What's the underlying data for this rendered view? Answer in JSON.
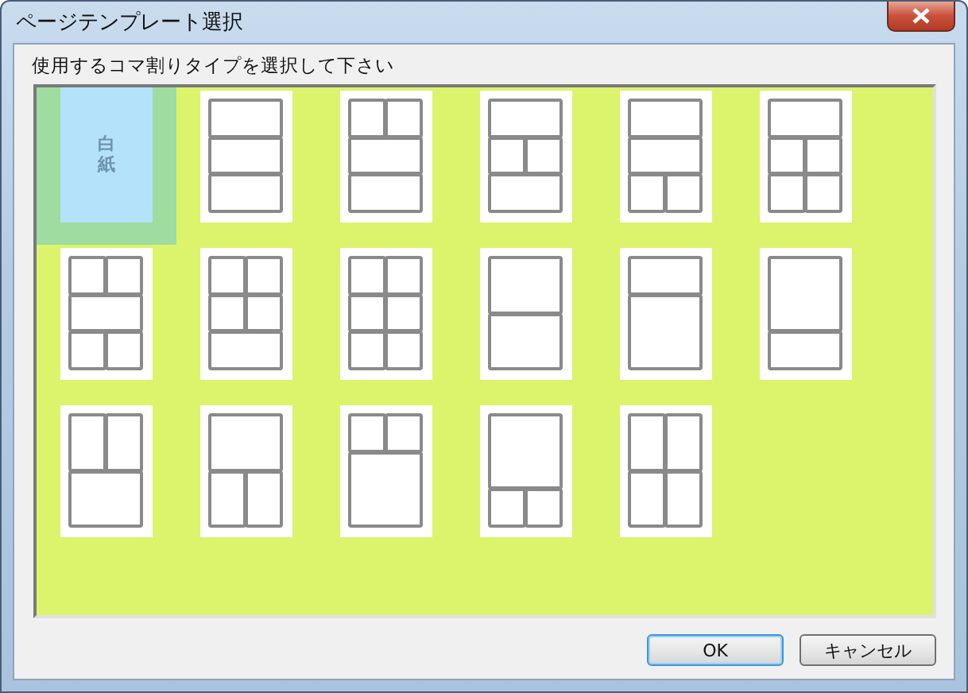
{
  "window": {
    "title": "ページテンプレート選択"
  },
  "instruction": "使用するコマ割りタイプを選択して下さい",
  "templates": [
    {
      "kind": "blank",
      "label": "白紙",
      "selected": true
    },
    {
      "kind": "r111",
      "selected": false
    },
    {
      "kind": "r211",
      "selected": false
    },
    {
      "kind": "r121",
      "selected": false
    },
    {
      "kind": "r112",
      "selected": false
    },
    {
      "kind": "r122",
      "selected": false
    },
    {
      "kind": "r212",
      "selected": false
    },
    {
      "kind": "r221",
      "selected": false
    },
    {
      "kind": "r222",
      "selected": false
    },
    {
      "kind": "r11",
      "selected": false
    },
    {
      "kind": "r1big1",
      "selected": false
    },
    {
      "kind": "rbig11",
      "selected": false
    },
    {
      "kind": "r21",
      "selected": false
    },
    {
      "kind": "r12",
      "selected": false
    },
    {
      "kind": "r2big1",
      "selected": false
    },
    {
      "kind": "rbig12",
      "selected": false
    },
    {
      "kind": "r22",
      "selected": false
    }
  ],
  "buttons": [
    {
      "label": "OK",
      "default": true
    },
    {
      "label": "キャンセル",
      "default": false
    }
  ]
}
